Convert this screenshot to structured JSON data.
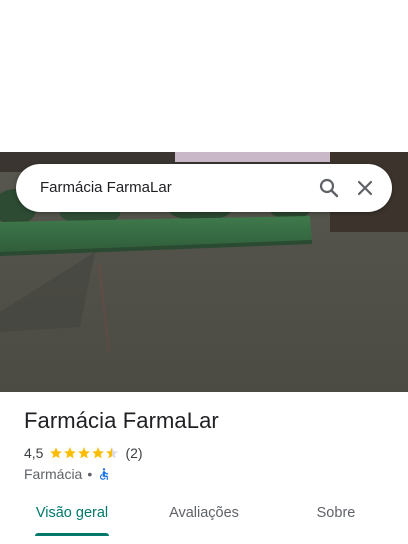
{
  "search": {
    "query": "Farmácia FarmaLar"
  },
  "place": {
    "name": "Farmácia FarmaLar",
    "rating": "4,5",
    "rating_stars": 4.5,
    "review_count": "(2)",
    "category": "Farmácia",
    "separator": "•",
    "wheelchair_accessible": true
  },
  "tabs": [
    {
      "label": "Visão geral",
      "active": true
    },
    {
      "label": "Avaliações",
      "active": false
    },
    {
      "label": "Sobre",
      "active": false
    }
  ],
  "colors": {
    "accent": "#00796b",
    "star": "#fbbc04",
    "accessible": "#1a73e8"
  }
}
